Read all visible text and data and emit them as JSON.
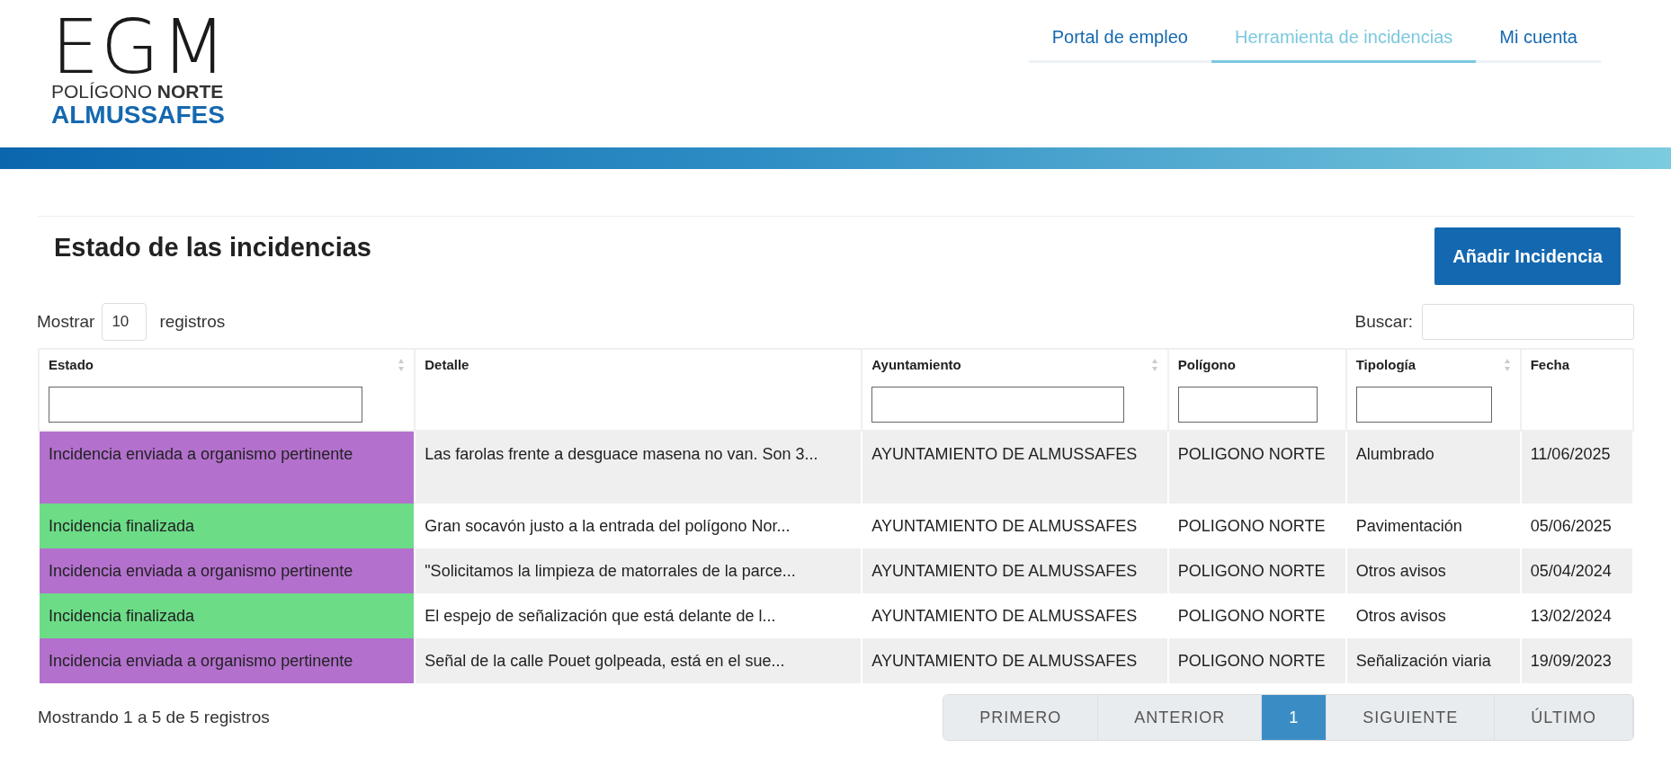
{
  "logo": {
    "mark": "EGM",
    "line1": "POLÍGONO **NORTE**",
    "line2": "ALMUSSAFES"
  },
  "nav": [
    {
      "label": "Portal de empleo",
      "selected": false
    },
    {
      "label": "Herramienta de incidencias",
      "selected": true
    },
    {
      "label": "Mi cuenta",
      "selected": false
    }
  ],
  "title": "Estado de las incidencias",
  "add_button": "Añadir Incidencia",
  "length": {
    "before": "Mostrar",
    "value": "10",
    "after": "registros"
  },
  "search": {
    "label": "Buscar:"
  },
  "table": {
    "columns": [
      {
        "label": "Estado",
        "sortable": true,
        "filter": true
      },
      {
        "label": "Detalle",
        "sortable": false,
        "filter": false
      },
      {
        "label": "Ayuntamiento",
        "sortable": true,
        "filter": true
      },
      {
        "label": "Polígono",
        "sortable": false,
        "filter": true
      },
      {
        "label": "Tipología",
        "sortable": true,
        "filter": true
      },
      {
        "label": "Fecha",
        "sortable": false,
        "filter": false
      }
    ],
    "rows": [
      {
        "estado": "Incidencia enviada a organismo pertinente",
        "color": "#b370cd",
        "detalle": "Las farolas frente a desguace masena no van. Son 3...",
        "ayuntamiento": "AYUNTAMIENTO DE ALMUSSAFES",
        "poligono": "POLIGONO NORTE",
        "tipologia": "Alumbrado",
        "fecha": "11/06/2025"
      },
      {
        "estado": "Incidencia finalizada",
        "color": "#6cdc87",
        "detalle": "Gran socavón justo a la entrada del polígono Nor...",
        "ayuntamiento": "AYUNTAMIENTO DE ALMUSSAFES",
        "poligono": "POLIGONO NORTE",
        "tipologia": "Pavimentación",
        "fecha": "05/06/2025"
      },
      {
        "estado": "Incidencia enviada a organismo pertinente",
        "color": "#b370cd",
        "detalle": "\"Solicitamos la limpieza de matorrales de la parce...",
        "ayuntamiento": "AYUNTAMIENTO DE ALMUSSAFES",
        "poligono": "POLIGONO NORTE",
        "tipologia": "Otros avisos",
        "fecha": "05/04/2024"
      },
      {
        "estado": "Incidencia finalizada",
        "color": "#6cdc87",
        "detalle": "El espejo de señalización que está delante de l...",
        "ayuntamiento": "AYUNTAMIENTO DE ALMUSSAFES",
        "poligono": "POLIGONO NORTE",
        "tipologia": "Otros avisos",
        "fecha": "13/02/2024"
      },
      {
        "estado": "Incidencia enviada a organismo pertinente",
        "color": "#b370cd",
        "detalle": "Señal de la calle Pouet golpeada, está en el sue...",
        "ayuntamiento": "AYUNTAMIENTO DE ALMUSSAFES",
        "poligono": "POLIGONO NORTE",
        "tipologia": "Señalización viaria",
        "fecha": "19/09/2023"
      }
    ]
  },
  "info": "Mostrando 1 a 5 de 5 registros",
  "pagination": [
    {
      "label": "PRIMERO",
      "selected": false
    },
    {
      "label": "ANTERIOR",
      "selected": false
    },
    {
      "label": "1",
      "selected": true
    },
    {
      "label": "SIGUIENTE",
      "selected": false
    },
    {
      "label": "ÚLTIMO",
      "selected": false
    }
  ]
}
